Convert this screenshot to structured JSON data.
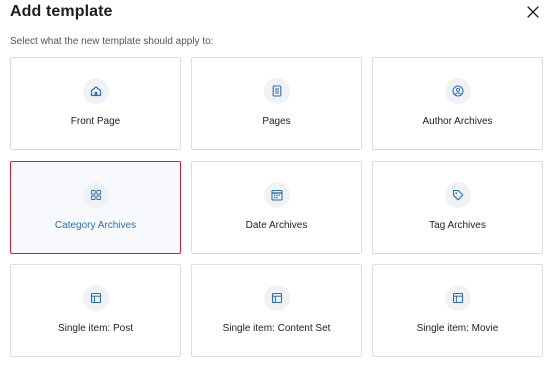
{
  "modal": {
    "title": "Add template",
    "subtitle": "Select what the new template should apply to:",
    "close_icon": "close-icon"
  },
  "tiles": [
    {
      "label": "Front Page",
      "icon": "home-icon",
      "selected": false
    },
    {
      "label": "Pages",
      "icon": "page-icon",
      "selected": false
    },
    {
      "label": "Author Archives",
      "icon": "author-icon",
      "selected": false
    },
    {
      "label": "Category Archives",
      "icon": "category-icon",
      "selected": true
    },
    {
      "label": "Date Archives",
      "icon": "calendar-icon",
      "selected": false
    },
    {
      "label": "Tag Archives",
      "icon": "tag-icon",
      "selected": false
    },
    {
      "label": "Single item: Post",
      "icon": "layout-icon",
      "selected": false
    },
    {
      "label": "Single item: Content Set",
      "icon": "layout-icon",
      "selected": false
    },
    {
      "label": "Single item: Movie",
      "icon": "layout-icon",
      "selected": false
    }
  ],
  "colors": {
    "accent": "#2a6fb0",
    "selected_border": "#d21f2b",
    "tile_border": "#dddddd",
    "icon_bg": "#f0f2f6"
  }
}
